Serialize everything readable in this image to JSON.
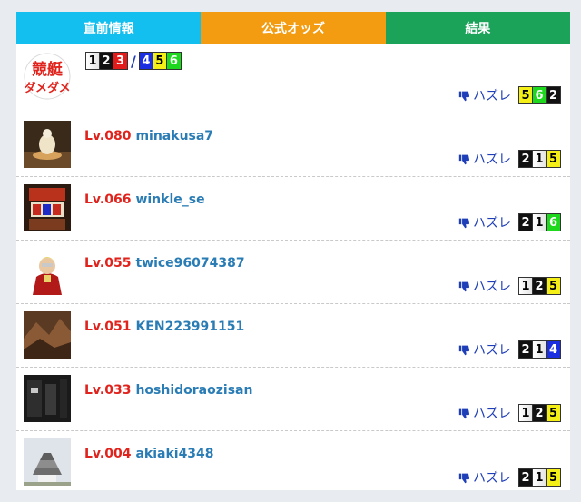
{
  "tabs": [
    {
      "label": "直前情報",
      "color": "#12bfee"
    },
    {
      "label": "公式オッズ",
      "color": "#f39c12"
    },
    {
      "label": "結果",
      "color": "#1ba35a"
    }
  ],
  "prediction": {
    "avatar_text": "競艇ダメダメ",
    "group_a": [
      "1",
      "2",
      "3"
    ],
    "group_b": [
      "4",
      "5",
      "6"
    ],
    "separator": "/",
    "result_label": "ハズレ",
    "combo": [
      "5",
      "6",
      "2"
    ]
  },
  "entries": [
    {
      "level": "Lv.080",
      "username": "minakusa7",
      "result_label": "ハズレ",
      "combo": [
        "2",
        "1",
        "5"
      ],
      "avatar_icon": "dessert-photo"
    },
    {
      "level": "Lv.066",
      "username": "winkle_se",
      "result_label": "ハズレ",
      "combo": [
        "2",
        "1",
        "6"
      ],
      "avatar_icon": "pachislot-photo"
    },
    {
      "level": "Lv.055",
      "username": "twice96074387",
      "result_label": "ハズレ",
      "combo": [
        "1",
        "2",
        "5"
      ],
      "avatar_icon": "anime-character"
    },
    {
      "level": "Lv.051",
      "username": "KEN223991151",
      "result_label": "ハズレ",
      "combo": [
        "2",
        "1",
        "4"
      ],
      "avatar_icon": "rock-photo"
    },
    {
      "level": "Lv.033",
      "username": "hoshidoraozisan",
      "result_label": "ハズレ",
      "combo": [
        "1",
        "2",
        "5"
      ],
      "avatar_icon": "dark-photo"
    },
    {
      "level": "Lv.004",
      "username": "akiaki4348",
      "result_label": "ハズレ",
      "combo": [
        "2",
        "1",
        "5"
      ],
      "avatar_icon": "castle-photo"
    }
  ]
}
